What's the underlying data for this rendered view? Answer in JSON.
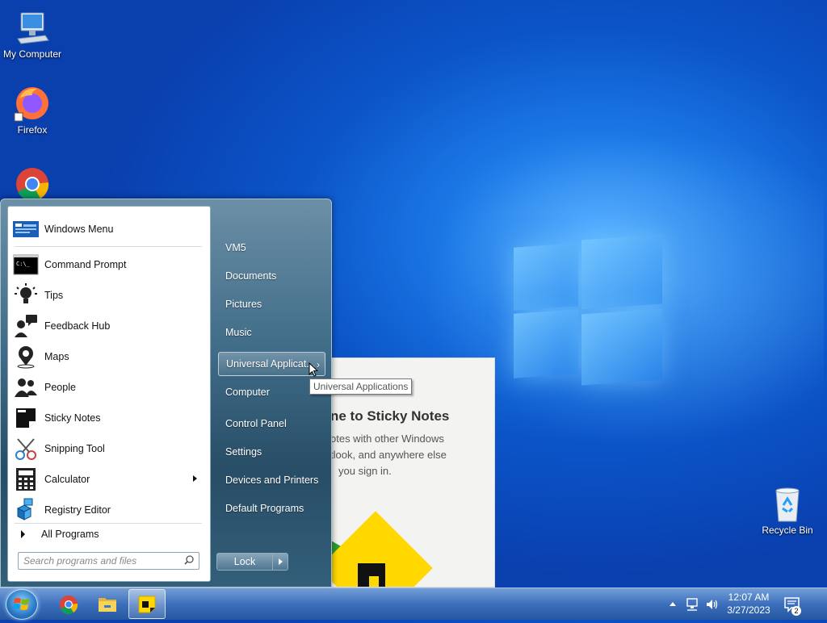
{
  "desktop": {
    "icons": [
      {
        "label": "My Computer"
      },
      {
        "label": "Firefox"
      },
      {
        "label": "Recycle Bin"
      }
    ]
  },
  "sticky_notes_window": {
    "heading": "ne to Sticky Notes",
    "body_lines": [
      "otes with other Windows",
      "tlook, and anywhere else",
      "you sign in."
    ]
  },
  "start_menu": {
    "programs": [
      {
        "label": "Windows Menu",
        "icon": "windows-menu-icon"
      },
      {
        "label": "Command Prompt",
        "icon": "command-prompt-icon"
      },
      {
        "label": "Tips",
        "icon": "lightbulb-icon"
      },
      {
        "label": "Feedback Hub",
        "icon": "feedback-hub-icon"
      },
      {
        "label": "Maps",
        "icon": "maps-icon"
      },
      {
        "label": "People",
        "icon": "people-icon"
      },
      {
        "label": "Sticky Notes",
        "icon": "sticky-notes-icon"
      },
      {
        "label": "Snipping Tool",
        "icon": "snipping-tool-icon"
      },
      {
        "label": "Calculator",
        "icon": "calculator-icon",
        "has_submenu": true
      },
      {
        "label": "Registry Editor",
        "icon": "registry-editor-icon"
      }
    ],
    "all_programs": "All Programs",
    "search_placeholder": "Search programs and files",
    "right_items": [
      {
        "label": "VM5"
      },
      {
        "label": "Documents"
      },
      {
        "label": "Pictures"
      },
      {
        "label": "Music"
      },
      {
        "label": "Universal Applicat...",
        "highlighted": true
      },
      {
        "label": "Computer"
      },
      {
        "label": "Control Panel"
      },
      {
        "label": "Settings"
      },
      {
        "label": "Devices and Printers"
      },
      {
        "label": "Default Programs"
      }
    ],
    "lock_label": "Lock",
    "tooltip": "Universal Applications"
  },
  "taskbar": {
    "time": "12:07 AM",
    "date": "3/27/2023",
    "notification_count": "2",
    "pinned": [
      "chrome-icon",
      "file-explorer-icon",
      "sticky-notes-icon"
    ]
  },
  "colors": {
    "wallpaper": "#0b55c9",
    "menu_glass": "#3e6b87",
    "sticky_yellow": "#ffd800"
  }
}
